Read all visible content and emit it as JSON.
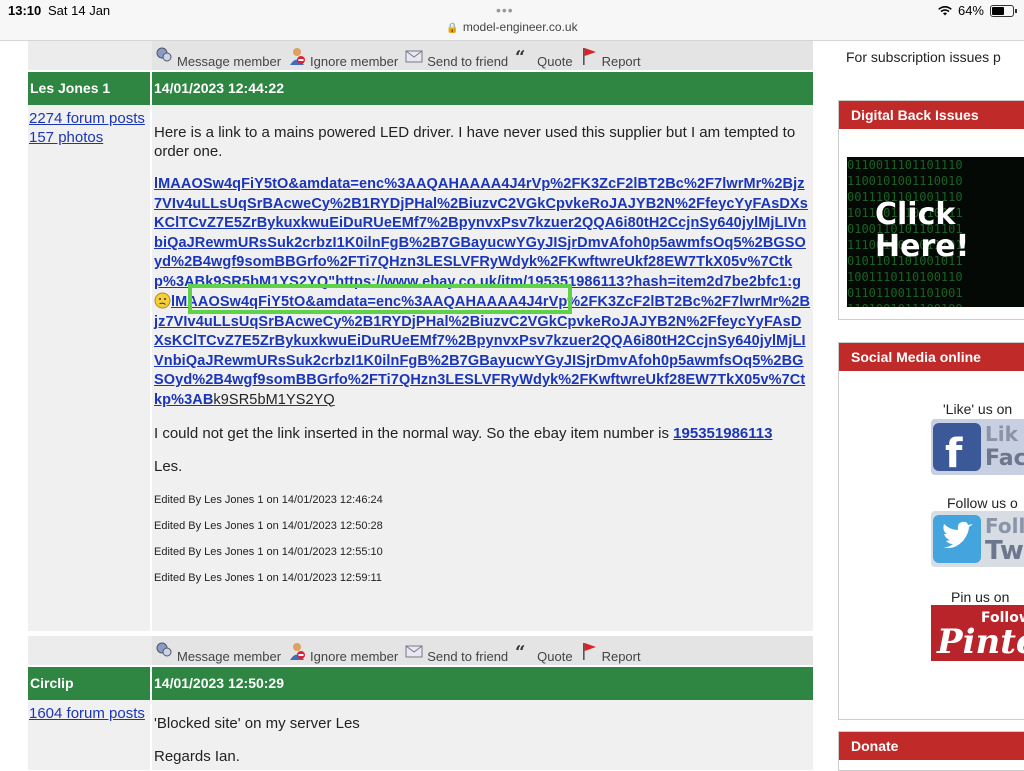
{
  "status_bar": {
    "time": "13:10",
    "date": "Sat 14 Jan",
    "url": "model-engineer.co.uk",
    "battery": "64%",
    "battery_level": 0.64
  },
  "actions": {
    "message": "Message member",
    "ignore": "Ignore member",
    "send": "Send to friend",
    "quote": "Quote",
    "report": "Report"
  },
  "post1": {
    "author": "Les Jones 1",
    "posts_link": "2274 forum posts",
    "photos_link": "157 photos",
    "date": "14/01/2023 12:44:22",
    "intro": "Here is a link to a mains powered LED driver. I have never used this supplier but I am tempted to order one.",
    "link_part1": "lMAAOSw4qFiY5tO&amdata=enc%3AAQAHAAAA4J4rVp%2FK3ZcF2lBT2Bc%2F7lwrMr%2Bjz7VIv4uLLsUqSrBAcweCy%2B1RYDjPHal%2BiuzvC2VGkCpvkeRoJAJYB2N%2FfeycYyFAsDXsKClTCvZ7E5ZrBykuxkwuEiDuRUeEMf7%2BpynvxPsv7kzuer2QQA6i80tH2CcjnSy640jylMjLIVnbiQaJRewmURsSuk2crbzI1K0ilnFgB%2B7GBayucwYGyJISjrDmvAfoh0p5awmfsOq5%2BGSOyd%2B4wgf9somBBGrfo%2FTi7QHzn3LESLVFRyWdyk%2FKwftwreUkf28EW7TkX05v%7Ctkp%3ABk9SR5bM1YS2YQ\"",
    "link_highlight": "https://www.ebay.co.uk/itm/195351986113",
    "link_part2": "?hash=item2d7be2bfc1:g",
    "link_part3": "lMAAOSw4qFiY5tO&amdata=enc%3AAQAHAAAA4J4rVp%2FK3ZcF2lBT2Bc%2F7lwrMr%2Bjz7VIv4uLLsUqSrBAcweCy%2B1RYDjPHal%2BiuzvC2VGkCpvkeRoJAJYB2N%2FfeycYyFAsDXsKClTCvZ7E5ZrBykuxkwuEiDuRUeEMf7%2BpynvxPsv7kzuer2QQA6i80tH2CcjnSy640jylMjLIVnbiQaJRewmURsSuk2crbzI1K0ilnFgB%2B7GBayucwYGyJISjrDmvAfoh0p5awmfsOq5%2BGSOyd%2B4wgf9somBBGrfo%2FTi7QHzn3LESLVFRyWdyk%2FKwftwreUkf28EW7TkX05v%7Ctkp%3AB",
    "link_tail": "k9SR5bM1YS2YQ",
    "noinsert": "I could not get the link inserted in the normal way. So the ebay item number is",
    "item_number": "195351986113",
    "signoff": "Les.",
    "edits": [
      "Edited By Les Jones 1 on 14/01/2023 12:46:24",
      "Edited By Les Jones 1 on 14/01/2023 12:50:28",
      "Edited By Les Jones 1 on 14/01/2023 12:55:10",
      "Edited By Les Jones 1 on 14/01/2023 12:59:11"
    ]
  },
  "post2": {
    "author": "Circlip",
    "posts_link": "1604 forum posts",
    "date": "14/01/2023 12:50:29",
    "line1": "'Blocked site' on my server Les",
    "line2": "Regards Ian."
  },
  "sidebar": {
    "subscription": "For subscription issues p",
    "digital_title": "Digital Back Issues",
    "click_here": "Click Here!",
    "social_title": "Social Media online",
    "like_label": "'Like' us on",
    "fb_text": "Lik Fac",
    "follow_label": "Follow us o",
    "tw_text": "Follo Tw",
    "pin_label": "Pin us on",
    "pin_text": "Follow Pinte",
    "donate_title": "Donate"
  }
}
